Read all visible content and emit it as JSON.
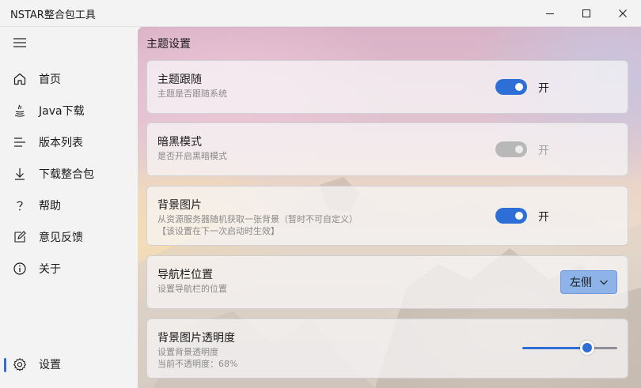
{
  "window": {
    "title": "NSTAR整合包工具",
    "controls": {
      "minimize_icon": "minimize-icon",
      "maximize_icon": "maximize-icon",
      "close_icon": "close-icon"
    }
  },
  "sidebar": {
    "menu_icon": "hamburger-icon",
    "items": [
      {
        "label": "首页",
        "icon": "home-icon"
      },
      {
        "label": "Java下载",
        "icon": "java-icon"
      },
      {
        "label": "版本列表",
        "icon": "list-icon"
      },
      {
        "label": "下载整合包",
        "icon": "download-icon"
      },
      {
        "label": "帮助",
        "icon": "help-icon"
      },
      {
        "label": "意见反馈",
        "icon": "feedback-icon"
      },
      {
        "label": "关于",
        "icon": "info-icon"
      }
    ],
    "footer_item": {
      "label": "设置",
      "icon": "gear-icon",
      "active": true
    }
  },
  "settings": {
    "section_title": "主题设置",
    "theme_follow": {
      "title": "主题跟随",
      "desc": "主题是否跟随系统",
      "state": "开",
      "on": true,
      "enabled": true
    },
    "dark_mode": {
      "title": "暗黑模式",
      "desc": "是否开启黑暗模式",
      "state": "开",
      "on": true,
      "enabled": false
    },
    "background_image": {
      "title": "背景图片",
      "desc_line1": "从资源服务器随机获取一张背景（暂时不可自定义）",
      "desc_line2": "【该设置在下一次启动时生效】",
      "state": "开",
      "on": true,
      "enabled": true
    },
    "nav_position": {
      "title": "导航栏位置",
      "desc": "设置导航栏的位置",
      "value": "左侧",
      "options_visible": [
        "左侧"
      ]
    },
    "bg_opacity": {
      "title": "背景图片透明度",
      "desc_line1": "设置背景透明度",
      "desc_line2": "当前不透明度：68%",
      "value_percent": 68
    }
  },
  "colors": {
    "accent": "#2d6fd6",
    "disabled_toggle": "#b8b8b8",
    "dropdown_bg": "#8db3e9"
  }
}
